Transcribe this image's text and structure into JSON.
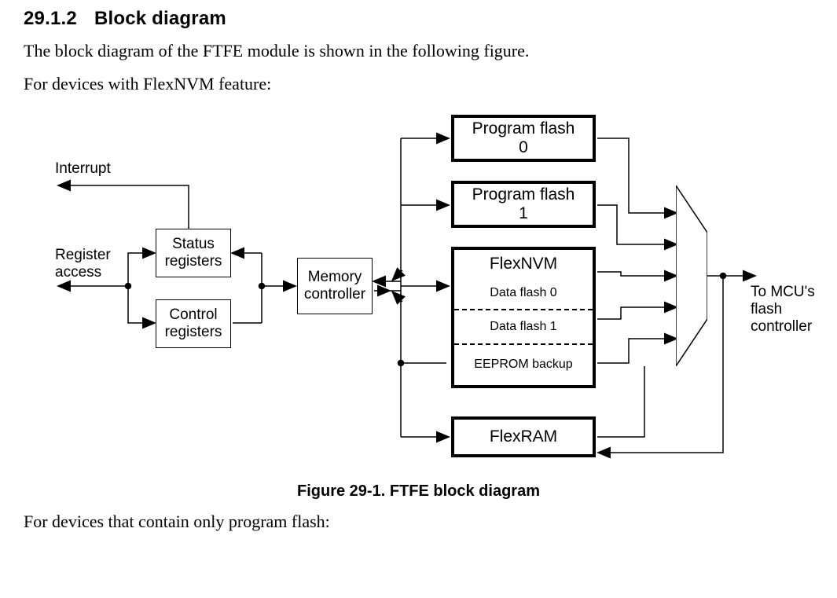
{
  "heading": {
    "number": "29.1.2",
    "title": "Block diagram"
  },
  "intro1": "The block diagram of the FTFE module is shown in the following figure.",
  "intro2": "For devices with FlexNVM feature:",
  "caption": "Figure 29-1. FTFE block diagram",
  "outro": "For devices that contain only program flash:",
  "labels": {
    "interrupt": "Interrupt",
    "register_access_l1": "Register",
    "register_access_l2": "access",
    "to_mcu_l1": "To MCU's",
    "to_mcu_l2": "flash controller"
  },
  "blocks": {
    "status_l1": "Status",
    "status_l2": "registers",
    "control_l1": "Control",
    "control_l2": "registers",
    "memctrl_l1": "Memory",
    "memctrl_l2": "controller",
    "pflash0_l1": "Program flash",
    "pflash0_l2": "0",
    "pflash1_l1": "Program flash",
    "pflash1_l2": "1",
    "flexnvm_title": "FlexNVM",
    "flexnvm_df0": "Data flash 0",
    "flexnvm_df1": "Data flash 1",
    "flexnvm_eep": "EEPROM backup",
    "flexram": "FlexRAM"
  }
}
